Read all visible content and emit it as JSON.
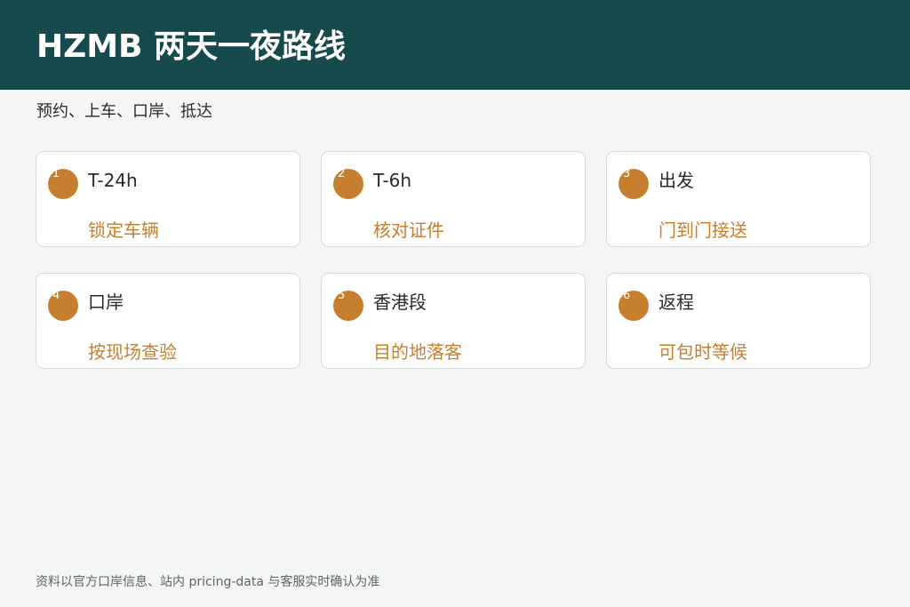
{
  "header": {
    "title": "HZMB 两天一夜路线",
    "bg_color": "#174a4c"
  },
  "subtitle": "预约、上车、口岸、抵达",
  "accent_color": "#c57f2f",
  "steps": [
    {
      "num": "1",
      "time": "T-24h",
      "action": "锁定车辆"
    },
    {
      "num": "2",
      "time": "T-6h",
      "action": "核对证件"
    },
    {
      "num": "3",
      "time": "出发",
      "action": "门到门接送"
    },
    {
      "num": "4",
      "time": "口岸",
      "action": "按现场查验"
    },
    {
      "num": "5",
      "time": "香港段",
      "action": "目的地落客"
    },
    {
      "num": "6",
      "time": "返程",
      "action": "可包时等候"
    }
  ],
  "footnote": "资料以官方口岸信息、站内 pricing-data 与客服实时确认为准"
}
